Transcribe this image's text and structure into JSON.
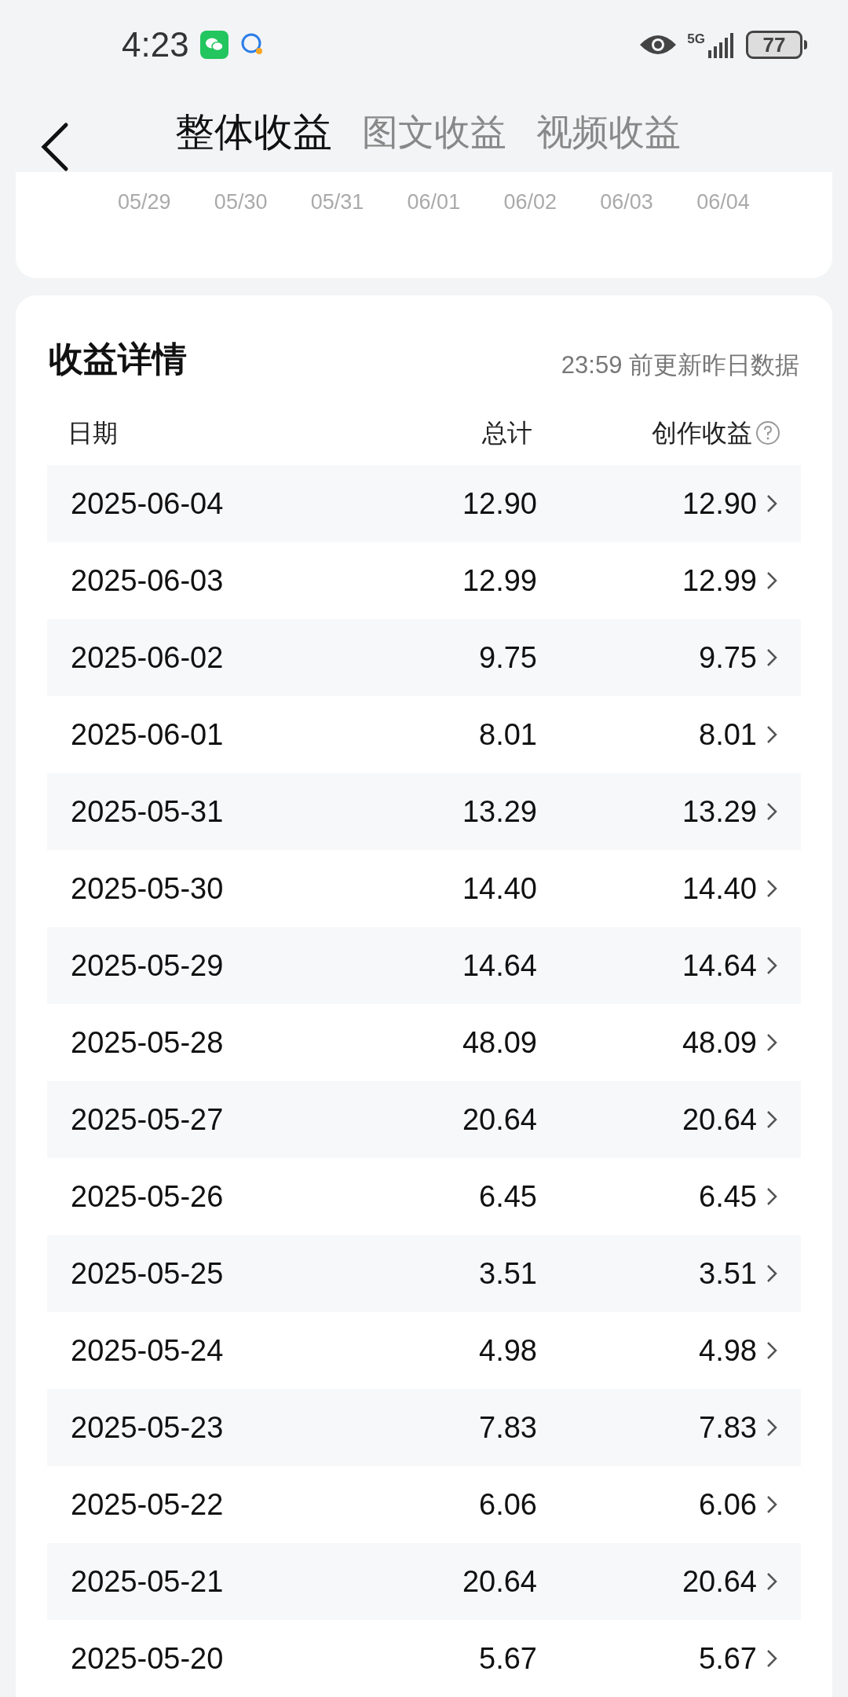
{
  "status_bar": {
    "time": "4:23",
    "network": "5G",
    "battery": "77"
  },
  "tabs": [
    {
      "label": "整体收益",
      "selected": true
    },
    {
      "label": "图文收益",
      "selected": false
    },
    {
      "label": "视频收益",
      "selected": false
    }
  ],
  "chart": {
    "x_labels": [
      "05/29",
      "05/30",
      "05/31",
      "06/01",
      "06/02",
      "06/03",
      "06/04"
    ]
  },
  "details": {
    "title": "收益详情",
    "note": "23:59 前更新昨日数据",
    "columns": [
      "日期",
      "总计",
      "创作收益"
    ],
    "rows": [
      {
        "date": "2025-06-04",
        "total": "12.90",
        "creation": "12.90"
      },
      {
        "date": "2025-06-03",
        "total": "12.99",
        "creation": "12.99"
      },
      {
        "date": "2025-06-02",
        "total": "9.75",
        "creation": "9.75"
      },
      {
        "date": "2025-06-01",
        "total": "8.01",
        "creation": "8.01"
      },
      {
        "date": "2025-05-31",
        "total": "13.29",
        "creation": "13.29"
      },
      {
        "date": "2025-05-30",
        "total": "14.40",
        "creation": "14.40"
      },
      {
        "date": "2025-05-29",
        "total": "14.64",
        "creation": "14.64"
      },
      {
        "date": "2025-05-28",
        "total": "48.09",
        "creation": "48.09"
      },
      {
        "date": "2025-05-27",
        "total": "20.64",
        "creation": "20.64"
      },
      {
        "date": "2025-05-26",
        "total": "6.45",
        "creation": "6.45"
      },
      {
        "date": "2025-05-25",
        "total": "3.51",
        "creation": "3.51"
      },
      {
        "date": "2025-05-24",
        "total": "4.98",
        "creation": "4.98"
      },
      {
        "date": "2025-05-23",
        "total": "7.83",
        "creation": "7.83"
      },
      {
        "date": "2025-05-22",
        "total": "6.06",
        "creation": "6.06"
      },
      {
        "date": "2025-05-21",
        "total": "20.64",
        "creation": "20.64"
      },
      {
        "date": "2025-05-20",
        "total": "5.67",
        "creation": "5.67"
      }
    ]
  }
}
